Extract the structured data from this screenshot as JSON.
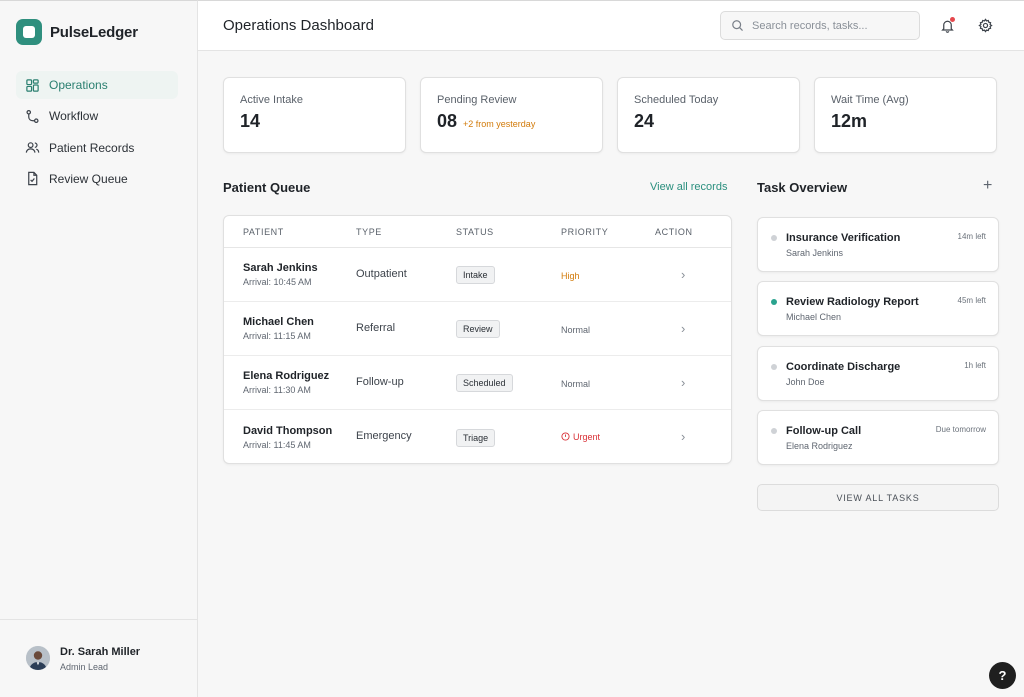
{
  "app": {
    "brand": "PulseLedger"
  },
  "nav": {
    "items": [
      {
        "label": "Operations",
        "icon": "grid-icon",
        "active": true
      },
      {
        "label": "Workflow",
        "icon": "workflow-icon",
        "active": false
      },
      {
        "label": "Patient Records",
        "icon": "users-icon",
        "active": false
      },
      {
        "label": "Review Queue",
        "icon": "document-check-icon",
        "active": false
      }
    ]
  },
  "user": {
    "name": "Dr. Sarah Miller",
    "role": "Admin Lead"
  },
  "header": {
    "title": "Operations Dashboard",
    "search_placeholder": "Search records, tasks..."
  },
  "stats": [
    {
      "label": "Active Intake",
      "value": "14",
      "delta": ""
    },
    {
      "label": "Pending Review",
      "value": "08",
      "delta": "+2 from yesterday"
    },
    {
      "label": "Scheduled Today",
      "value": "24",
      "delta": ""
    },
    {
      "label": "Wait Time (Avg)",
      "value": "12m",
      "delta": ""
    }
  ],
  "queue": {
    "title": "Patient Queue",
    "view_all": "View all records",
    "columns": [
      "PATIENT",
      "TYPE",
      "STATUS",
      "PRIORITY",
      "ACTION"
    ],
    "rows": [
      {
        "name": "Sarah Jenkins",
        "arrival": "Arrival: 10:45 AM",
        "type": "Outpatient",
        "status": "Intake",
        "priority": "High"
      },
      {
        "name": "Michael Chen",
        "arrival": "Arrival: 11:15 AM",
        "type": "Referral",
        "status": "Review",
        "priority": "Normal"
      },
      {
        "name": "Elena Rodriguez",
        "arrival": "Arrival: 11:30 AM",
        "type": "Follow-up",
        "status": "Scheduled",
        "priority": "Normal"
      },
      {
        "name": "David Thompson",
        "arrival": "Arrival: 11:45 AM",
        "type": "Emergency",
        "status": "Triage",
        "priority": "Urgent"
      }
    ]
  },
  "tasks": {
    "title": "Task Overview",
    "add_label": "+",
    "items": [
      {
        "title": "Insurance Verification",
        "patient": "Sarah Jenkins",
        "due": "14m left",
        "active": false
      },
      {
        "title": "Review Radiology Report",
        "patient": "Michael Chen",
        "due": "45m left",
        "active": true
      },
      {
        "title": "Coordinate Discharge",
        "patient": "John Doe",
        "due": "1h left",
        "active": false
      },
      {
        "title": "Follow-up Call",
        "patient": "Elena Rodriguez",
        "due": "Due tomorrow",
        "active": false
      }
    ],
    "view_all": "VIEW ALL TASKS"
  },
  "help": {
    "label": "?"
  },
  "colors": {
    "accent": "#2a8f7e",
    "warning": "#d27b0b",
    "danger": "#d93036"
  }
}
